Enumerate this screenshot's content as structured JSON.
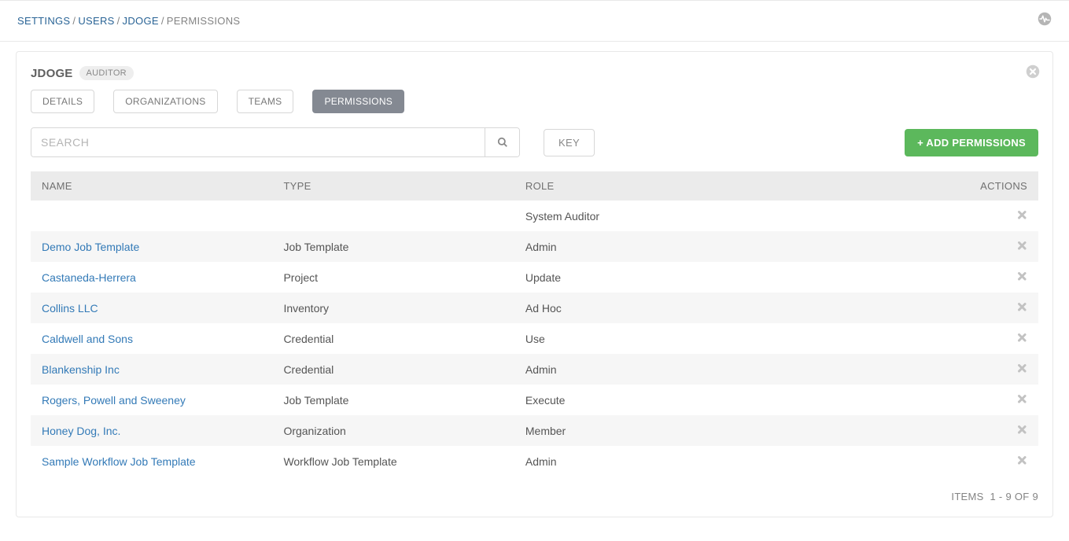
{
  "breadcrumb": {
    "items": [
      {
        "label": "SETTINGS",
        "link": true
      },
      {
        "label": "USERS",
        "link": true
      },
      {
        "label": "JDOGE",
        "link": true
      },
      {
        "label": "PERMISSIONS",
        "link": false
      }
    ]
  },
  "panel": {
    "title": "JDOGE",
    "badge": "AUDITOR"
  },
  "tabs": {
    "items": [
      {
        "label": "DETAILS",
        "active": false
      },
      {
        "label": "ORGANIZATIONS",
        "active": false
      },
      {
        "label": "TEAMS",
        "active": false
      },
      {
        "label": "PERMISSIONS",
        "active": true
      }
    ]
  },
  "search": {
    "placeholder": "SEARCH"
  },
  "buttons": {
    "key": "KEY",
    "add": "+ ADD PERMISSIONS"
  },
  "table": {
    "headers": {
      "name": "NAME",
      "type": "TYPE",
      "role": "ROLE",
      "actions": "ACTIONS"
    },
    "rows": [
      {
        "name": "",
        "link": false,
        "type": "",
        "role": "System Auditor"
      },
      {
        "name": "Demo Job Template",
        "link": true,
        "type": "Job Template",
        "role": "Admin"
      },
      {
        "name": "Castaneda-Herrera",
        "link": true,
        "type": "Project",
        "role": "Update"
      },
      {
        "name": "Collins LLC",
        "link": true,
        "type": "Inventory",
        "role": "Ad Hoc"
      },
      {
        "name": "Caldwell and Sons",
        "link": true,
        "type": "Credential",
        "role": "Use"
      },
      {
        "name": "Blankenship Inc",
        "link": true,
        "type": "Credential",
        "role": "Admin"
      },
      {
        "name": "Rogers, Powell and Sweeney",
        "link": true,
        "type": "Job Template",
        "role": "Execute"
      },
      {
        "name": "Honey Dog, Inc.",
        "link": true,
        "type": "Organization",
        "role": "Member"
      },
      {
        "name": "Sample Workflow Job Template",
        "link": true,
        "type": "Workflow Job Template",
        "role": "Admin"
      }
    ]
  },
  "pager": {
    "label": "ITEMS",
    "range": "1 - 9 OF 9"
  }
}
